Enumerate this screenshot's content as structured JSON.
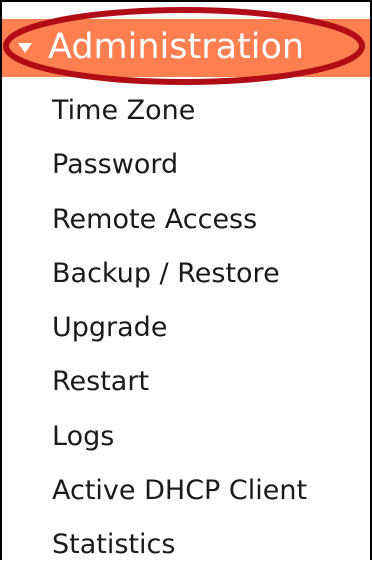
{
  "menu": {
    "header_label": "Administration",
    "header_color": "#ff7f50",
    "highlight_color": "#b10d16",
    "items": [
      {
        "label": "Time Zone"
      },
      {
        "label": "Password"
      },
      {
        "label": "Remote Access"
      },
      {
        "label": "Backup / Restore"
      },
      {
        "label": "Upgrade"
      },
      {
        "label": "Restart"
      },
      {
        "label": "Logs"
      },
      {
        "label": "Active DHCP Client"
      },
      {
        "label": "Statistics"
      }
    ]
  }
}
